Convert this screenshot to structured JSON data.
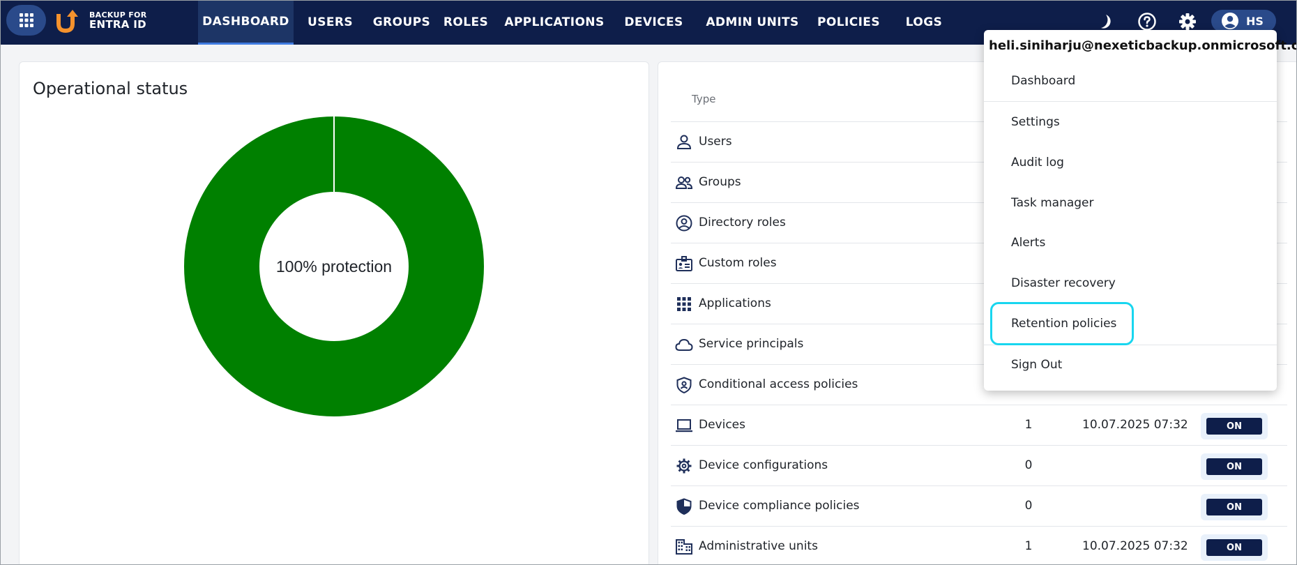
{
  "header": {
    "logo": {
      "line1": "BACKUP FOR",
      "line2": "ENTRA ID"
    },
    "nav": [
      {
        "label": "DASHBOARD",
        "active": true
      },
      {
        "label": "USERS"
      },
      {
        "label": "GROUPS"
      },
      {
        "label": "ROLES"
      },
      {
        "label": "APPLICATIONS"
      },
      {
        "label": "DEVICES"
      },
      {
        "label": "ADMIN UNITS"
      },
      {
        "label": "POLICIES"
      },
      {
        "label": "LOGS"
      }
    ],
    "icons": [
      "moon-icon",
      "help-icon",
      "gear-icon"
    ],
    "user_initials": "HS",
    "colors": {
      "bar": "#0e1e4a",
      "accent": "#3f7be0",
      "logo_orange": "#f4922d"
    }
  },
  "status_card": {
    "title": "Operational status",
    "donut_label": "100% protection",
    "protection_percent": 100,
    "donut_color": "#008000"
  },
  "table": {
    "type_header": "Type",
    "rows": [
      {
        "icon": "user-icon",
        "name": "Users",
        "count": "",
        "date": "",
        "toggle": ""
      },
      {
        "icon": "groups-icon",
        "name": "Groups",
        "count": "",
        "date": "",
        "toggle": ""
      },
      {
        "icon": "account-circle-icon",
        "name": "Directory roles",
        "count": "",
        "date": "",
        "toggle": ""
      },
      {
        "icon": "badge-icon",
        "name": "Custom roles",
        "count": "",
        "date": "",
        "toggle": ""
      },
      {
        "icon": "apps-grid-icon",
        "name": "Applications",
        "count": "",
        "date": "",
        "toggle": ""
      },
      {
        "icon": "cloud-icon",
        "name": "Service principals",
        "count": "",
        "date": "",
        "toggle": ""
      },
      {
        "icon": "shield-lock-icon",
        "name": "Conditional access policies",
        "count": "",
        "date": "",
        "toggle": ""
      },
      {
        "icon": "laptop-icon",
        "name": "Devices",
        "count": "1",
        "date": "10.07.2025 07:32",
        "toggle": "ON"
      },
      {
        "icon": "gear-icon",
        "name": "Device configurations",
        "count": "0",
        "date": "",
        "toggle": "ON"
      },
      {
        "icon": "shield-half-icon",
        "name": "Device compliance policies",
        "count": "0",
        "date": "",
        "toggle": "ON"
      },
      {
        "icon": "building-icon",
        "name": "Administrative units",
        "count": "1",
        "date": "10.07.2025 07:32",
        "toggle": "ON"
      }
    ]
  },
  "user_menu": {
    "email": "heli.siniharju@nexeticbackup.onmicrosoft.com",
    "items": [
      {
        "label": "Dashboard"
      },
      {
        "label": "Settings"
      },
      {
        "label": "Audit log"
      },
      {
        "label": "Task manager"
      },
      {
        "label": "Alerts"
      },
      {
        "label": "Disaster recovery"
      },
      {
        "label": "Retention policies",
        "highlighted": true
      },
      {
        "label": "Sign Out"
      }
    ],
    "highlight_color": "#18d6ef"
  }
}
